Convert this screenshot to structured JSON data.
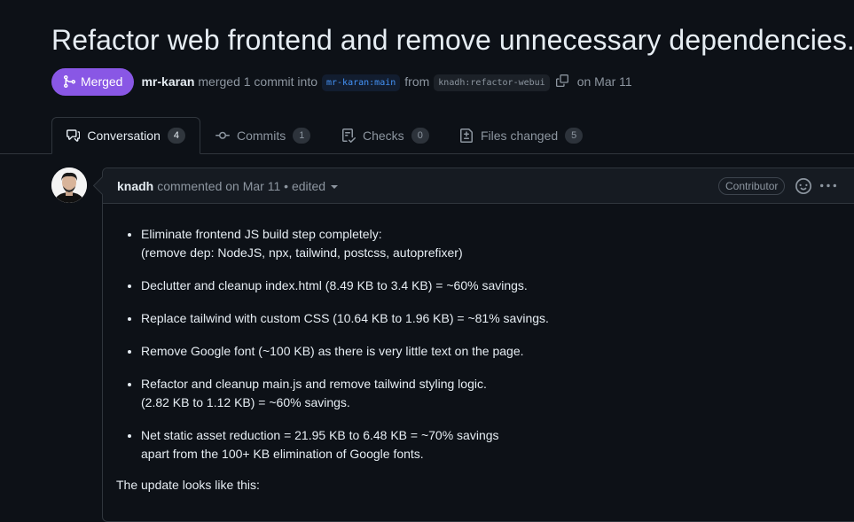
{
  "pr": {
    "title": "Refactor web frontend and remove unnecessary dependencies.",
    "status": "Merged",
    "author": "mr-karan",
    "action": "merged 1 commit into",
    "base_branch": "mr-karan:main",
    "from_text": "from",
    "head_branch": "knadh:refactor-webui",
    "date_text": "on Mar 11"
  },
  "tabs": [
    {
      "label": "Conversation",
      "count": "4",
      "icon": "comment-discussion-icon"
    },
    {
      "label": "Commits",
      "count": "1",
      "icon": "commit-icon"
    },
    {
      "label": "Checks",
      "count": "0",
      "icon": "checklist-icon"
    },
    {
      "label": "Files changed",
      "count": "5",
      "icon": "file-diff-icon"
    }
  ],
  "comment": {
    "author": "knadh",
    "meta": "commented on Mar 11 • edited",
    "role": "Contributor",
    "bullets": [
      {
        "line1": "Eliminate frontend JS build step completely:",
        "line2": "(remove dep: NodeJS, npx, tailwind, postcss, autoprefixer)"
      },
      {
        "line1": "Declutter and cleanup index.html (8.49 KB to 3.4 KB) = ~60% savings.",
        "line2": ""
      },
      {
        "line1": "Replace tailwind with custom CSS (10.64 KB to 1.96 KB) = ~81% savings.",
        "line2": ""
      },
      {
        "line1": "Remove Google font (~100 KB) as there is very little text on the page.",
        "line2": ""
      },
      {
        "line1": "Refactor and cleanup main.js and remove tailwind styling logic.",
        "line2": "(2.82 KB to 1.12 KB) = ~60% savings."
      },
      {
        "line1": "Net static asset reduction = 21.95 KB to 6.48 KB = ~70% savings",
        "line2": "apart from the 100+ KB elimination of Google fonts."
      }
    ],
    "footer_text": "The update looks like this:"
  },
  "colors": {
    "background": "#0d1117",
    "merged": "#8957e5",
    "link": "#4493f8",
    "border": "#30363d"
  }
}
